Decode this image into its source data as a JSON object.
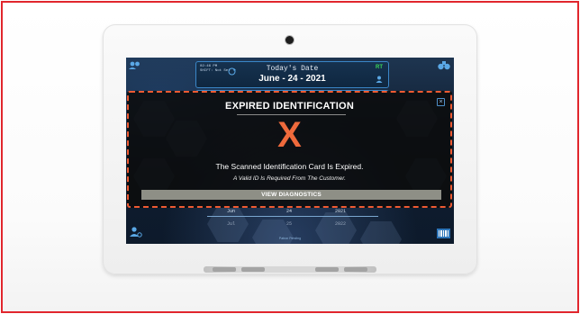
{
  "header": {
    "date_small_line1": "02:46 PM",
    "date_small_line2": "SHIFT: Not Set",
    "title": "Today's Date",
    "date_value": "June - 24 - 2021",
    "badge": "RT"
  },
  "alert": {
    "title": "EXPIRED IDENTIFICATION",
    "mark": "X",
    "message": "The Scanned Identification Card Is Expired.",
    "sub_message": "A Valid ID Is Required From The Customer.",
    "button_label": "VIEW DIAGNOSTICS",
    "close_label": "×"
  },
  "date_picker": {
    "row1": [
      "Jun",
      "24",
      "2021"
    ],
    "row2": [
      "Jul",
      "25",
      "2022"
    ]
  },
  "footer": {
    "status": "Patron Pending"
  },
  "icons": {
    "top_left": "people-settings-icon",
    "top_right": "binoculars-icon",
    "bottom_left": "users-settings-icon",
    "bottom_right": "barcode-icon"
  },
  "colors": {
    "alert_border": "#ee5a32",
    "x_mark": "#ef6a3c",
    "accent_blue": "#3a86c8",
    "rt_badge": "#3bd55a",
    "button": "#8e8f86"
  }
}
